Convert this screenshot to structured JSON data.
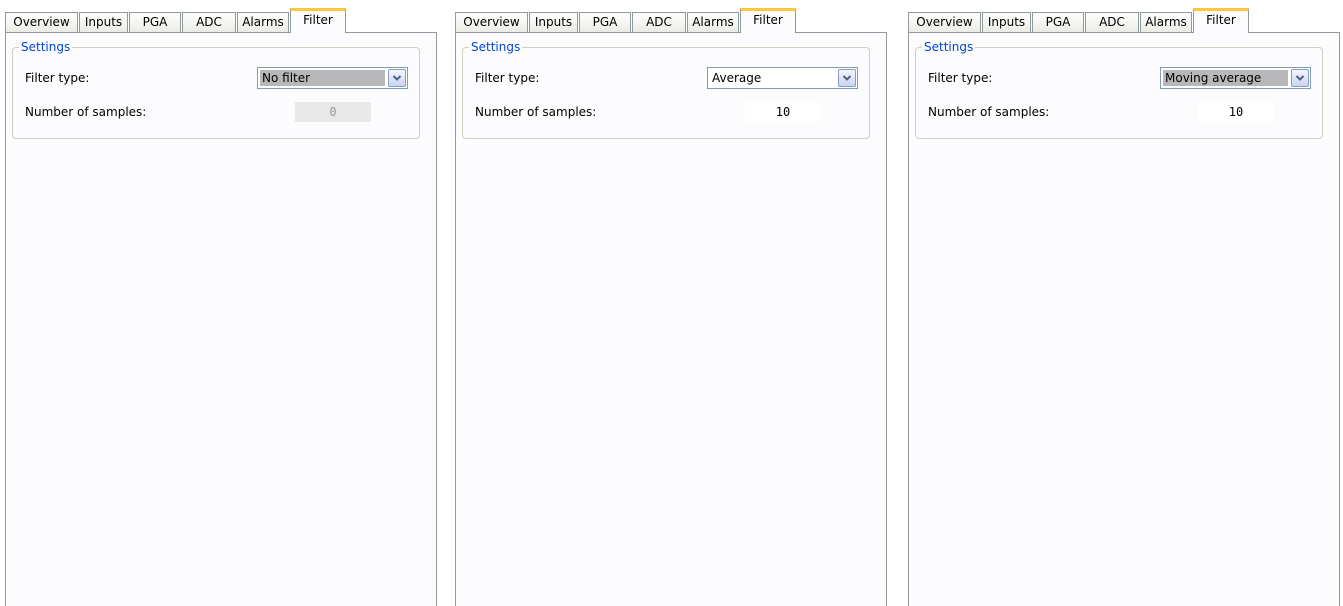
{
  "panels": [
    {
      "tabs": [
        "Overview",
        "Inputs",
        "PGA",
        "ADC",
        "Alarms",
        "Filter"
      ],
      "active_tab": "Filter",
      "group_title": "Settings",
      "filter_type_label": "Filter type:",
      "filter_type_value": "No filter",
      "num_samples_label": "Number of samples:",
      "num_samples_value": "0",
      "num_samples_enabled": false,
      "combo_focused": true
    },
    {
      "tabs": [
        "Overview",
        "Inputs",
        "PGA",
        "ADC",
        "Alarms",
        "Filter"
      ],
      "active_tab": "Filter",
      "group_title": "Settings",
      "filter_type_label": "Filter type:",
      "filter_type_value": "Average",
      "num_samples_label": "Number of samples:",
      "num_samples_value": "10",
      "num_samples_enabled": true,
      "combo_focused": false
    },
    {
      "tabs": [
        "Overview",
        "Inputs",
        "PGA",
        "ADC",
        "Alarms",
        "Filter"
      ],
      "active_tab": "Filter",
      "group_title": "Settings",
      "filter_type_label": "Filter type:",
      "filter_type_value": "Moving average",
      "num_samples_label": "Number of samples:",
      "num_samples_value": "10",
      "num_samples_enabled": true,
      "combo_focused": true
    }
  ],
  "colors": {
    "active_tab_accent": "#ffc83c",
    "group_title": "#0046d5",
    "border": "#919b9c"
  },
  "icons": {
    "combo_button": "chevron-down-icon"
  }
}
